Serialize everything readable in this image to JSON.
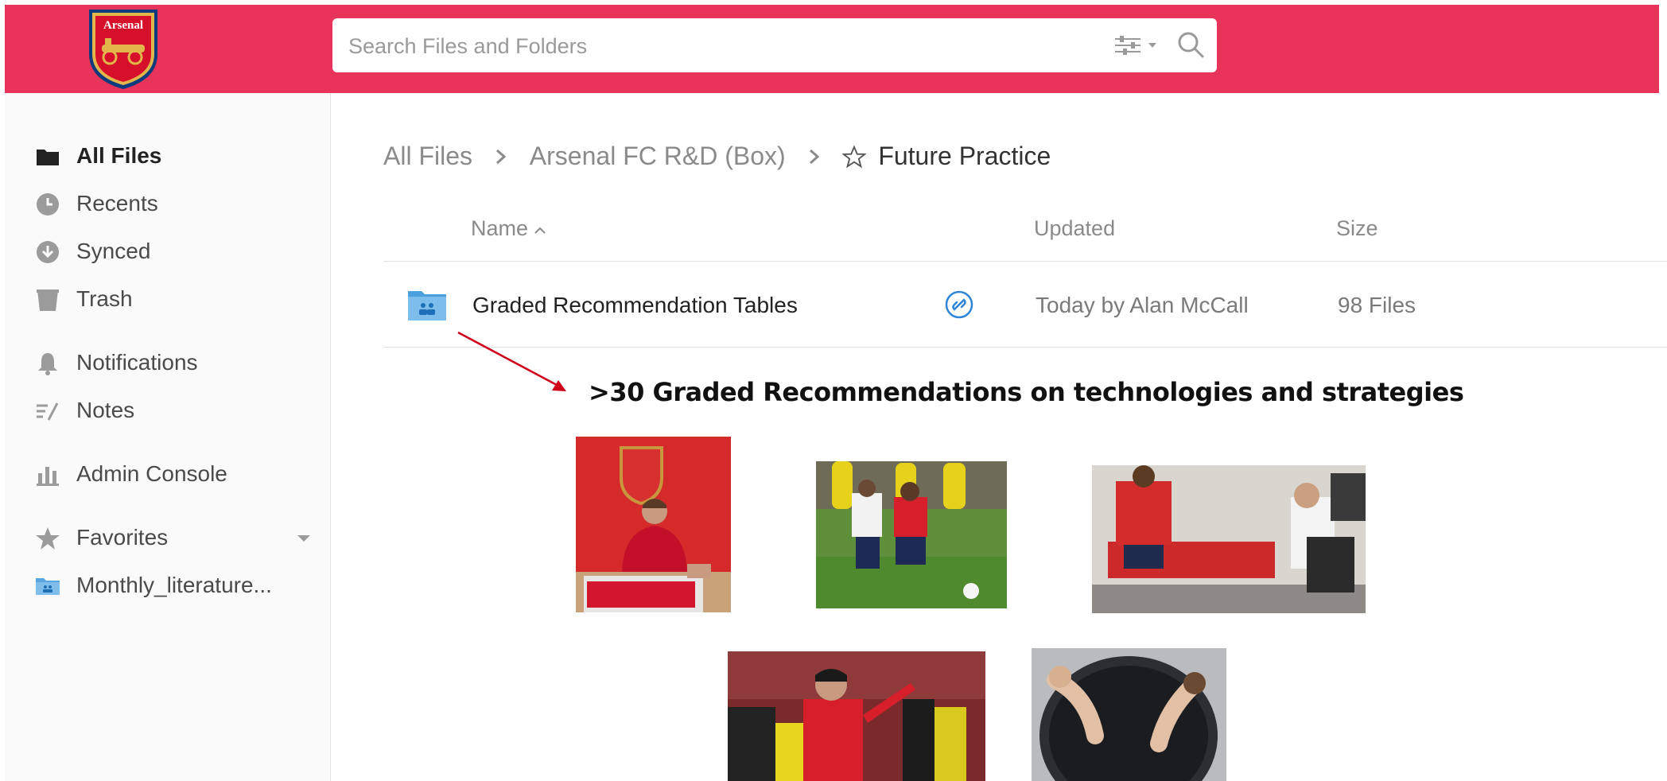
{
  "header": {
    "logo_text": "Arsenal",
    "search_placeholder": "Search Files and Folders",
    "brand_color": "#e8345a"
  },
  "sidebar": {
    "items": [
      {
        "label": "All Files",
        "icon": "folder-icon",
        "active": true
      },
      {
        "label": "Recents",
        "icon": "clock-icon"
      },
      {
        "label": "Synced",
        "icon": "sync-download-icon"
      },
      {
        "label": "Trash",
        "icon": "trash-icon"
      },
      {
        "label": "Notifications",
        "icon": "bell-icon"
      },
      {
        "label": "Notes",
        "icon": "notes-icon"
      },
      {
        "label": "Admin Console",
        "icon": "bar-chart-icon"
      },
      {
        "label": "Favorites",
        "icon": "star-icon"
      },
      {
        "label": "Monthly_literature...",
        "icon": "shared-folder-icon"
      }
    ]
  },
  "breadcrumb": {
    "items": [
      "All Files",
      "Arsenal FC R&D (Box)"
    ],
    "current": "Future Practice"
  },
  "table": {
    "columns": {
      "name": "Name",
      "updated": "Updated",
      "size": "Size"
    },
    "rows": [
      {
        "name": "Graded Recommendation Tables",
        "updated": "Today by Alan McCall",
        "size": "98 Files"
      }
    ]
  },
  "annotation": {
    "text": ">30 Graded Recommendations on technologies and strategies",
    "arrow_color": "#d0021b"
  },
  "photos": [
    {
      "name": "player-signing-photo"
    },
    {
      "name": "training-drill-photo"
    },
    {
      "name": "physio-assessment-photo"
    },
    {
      "name": "coach-sideline-photo"
    },
    {
      "name": "ice-bath-photo"
    }
  ]
}
